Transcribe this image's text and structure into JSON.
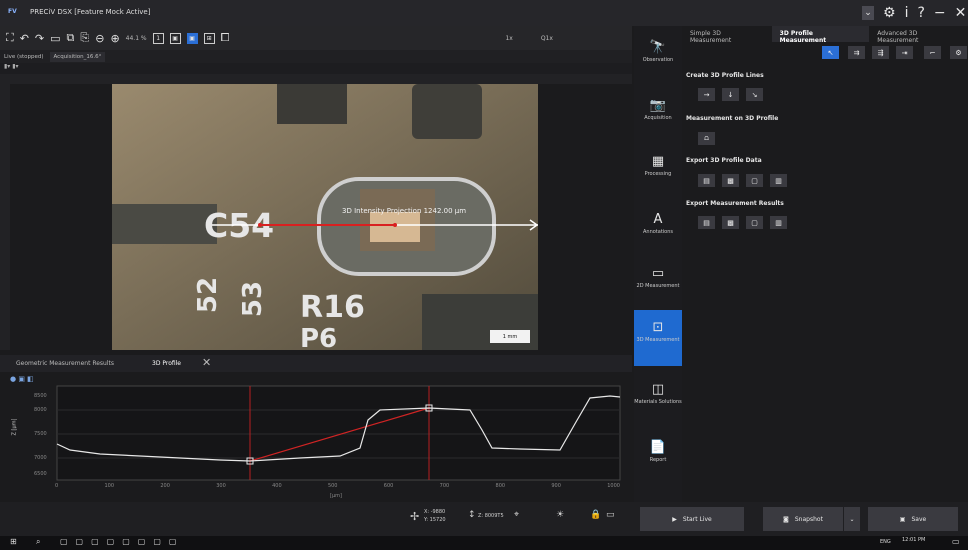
{
  "app": {
    "logo": "FV",
    "title": "PRECiV DSX [Feature Mock Active]"
  },
  "window": {
    "chevron": "⌄",
    "gear": "⚙",
    "info": "i",
    "help": "?",
    "min": "−",
    "close": "✕"
  },
  "toolbar": {
    "zoom": "44.1 %",
    "nav1": "1x",
    "nav2": "Q1x"
  },
  "tabs": {
    "live": "Live (stopped)",
    "acq": "Acquisition_16.6°"
  },
  "image": {
    "c54": "C54",
    "s52": "52",
    "s53": "53",
    "r16": "R16",
    "p6": "P6",
    "projection": "3D Intensity Projection 1242.00 µm",
    "scale": "1 mm"
  },
  "lower": {
    "tab1": "Geometric Measurement Results",
    "tab2": "3D Profile",
    "unitx": "[µm]",
    "unity": "Z [µm]"
  },
  "axis_x": [
    "0",
    "100",
    "200",
    "300",
    "400",
    "500",
    "600",
    "700",
    "800",
    "900",
    "1000"
  ],
  "axis_y": [
    "8500",
    "8000",
    "7500",
    "7000",
    "6500"
  ],
  "coords": {
    "x": "X: -9880",
    "y": "Y: 15720",
    "z": "Z: 8009T5"
  },
  "side": [
    {
      "label": "Observation",
      "icon": "🔭"
    },
    {
      "label": "Acquisition",
      "icon": "📷"
    },
    {
      "label": "Processing",
      "icon": "▦"
    },
    {
      "label": "Annotations",
      "icon": "A"
    },
    {
      "label": "2D Measurement",
      "icon": "▭"
    },
    {
      "label": "3D Measurement",
      "icon": "⊡"
    },
    {
      "label": "Materials Solutions",
      "icon": "◫"
    },
    {
      "label": "Report",
      "icon": "📄"
    }
  ],
  "right": {
    "tabs": [
      "Simple 3D Measurement",
      "3D Profile Measurement",
      "Advanced 3D Measurement"
    ],
    "sec1": "Create 3D Profile Lines",
    "sec2": "Measurement on 3D Profile",
    "sec3": "Export 3D Profile Data",
    "sec4": "Export Measurement Results"
  },
  "bottom": {
    "start": "Start Live",
    "snap": "Snapshot",
    "save": "Save"
  },
  "taskbar": {
    "time": "12:01 PM",
    "lang": "ENG"
  }
}
